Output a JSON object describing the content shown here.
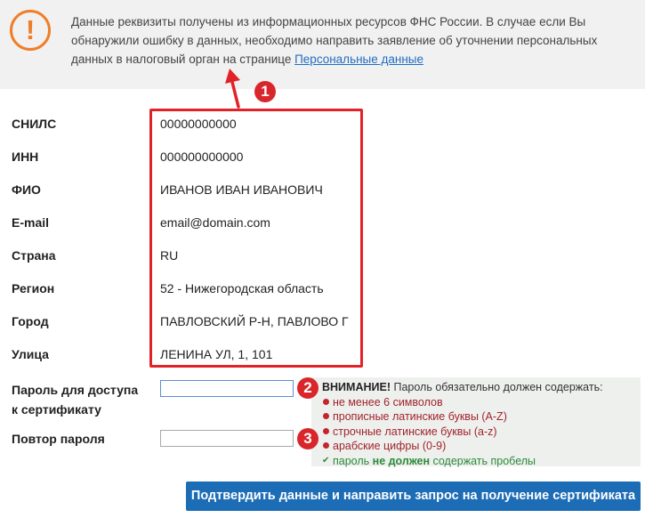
{
  "notice": {
    "icon": "exclamation-icon",
    "text": "Данные реквизиты получены из информационных ресурсов ФНС России. В случае если Вы обнаружили ошибку в данных, необходимо направить заявление об уточнении персональных данных в налоговый орган на странице ",
    "link": "Персональные данные",
    "color_accent": "#f07e29",
    "color_link": "#1f6ec3"
  },
  "badges": [
    "1",
    "2",
    "3"
  ],
  "fields": [
    {
      "label": "СНИЛС",
      "value": "00000000000"
    },
    {
      "label": "ИНН",
      "value": "000000000000"
    },
    {
      "label": "ФИО",
      "value": "ИВАНОВ ИВАН ИВАНОВИЧ"
    },
    {
      "label": "E-mail",
      "value": "email@domain.com"
    },
    {
      "label": "Страна",
      "value": "RU"
    },
    {
      "label": "Регион",
      "value": "52 - Нижегородская область"
    },
    {
      "label": "Город",
      "value": "ПАВЛОВСКИЙ Р-Н, ПАВЛОВО Г"
    },
    {
      "label": "Улица",
      "value": "ЛЕНИНА УЛ, 1, 101"
    }
  ],
  "password": {
    "label_line1": "Пароль для доступа",
    "label_line2": "к сертификату",
    "value": "",
    "repeat_label": "Повтор пароля",
    "repeat_value": ""
  },
  "rules": {
    "title_bold": "ВНИМАНИЕ!",
    "title_rest": " Пароль обязательно должен содержать:",
    "items": [
      "не менее 6 символов",
      "прописные латинские буквы (A-Z)",
      "строчные латинские буквы (a-z)",
      "арабские цифры (0-9)"
    ],
    "ok_prefix": "пароль ",
    "ok_bold": "не должен",
    "ok_suffix": " содержать пробелы",
    "color_error": "#a1242b",
    "color_ok": "#2d8a3a"
  },
  "submit_label": "Подтвердить данные и направить запрос на получение сертификата",
  "colors": {
    "highlight": "#e32228",
    "button": "#1d6cb6",
    "badge": "#d9262b"
  }
}
